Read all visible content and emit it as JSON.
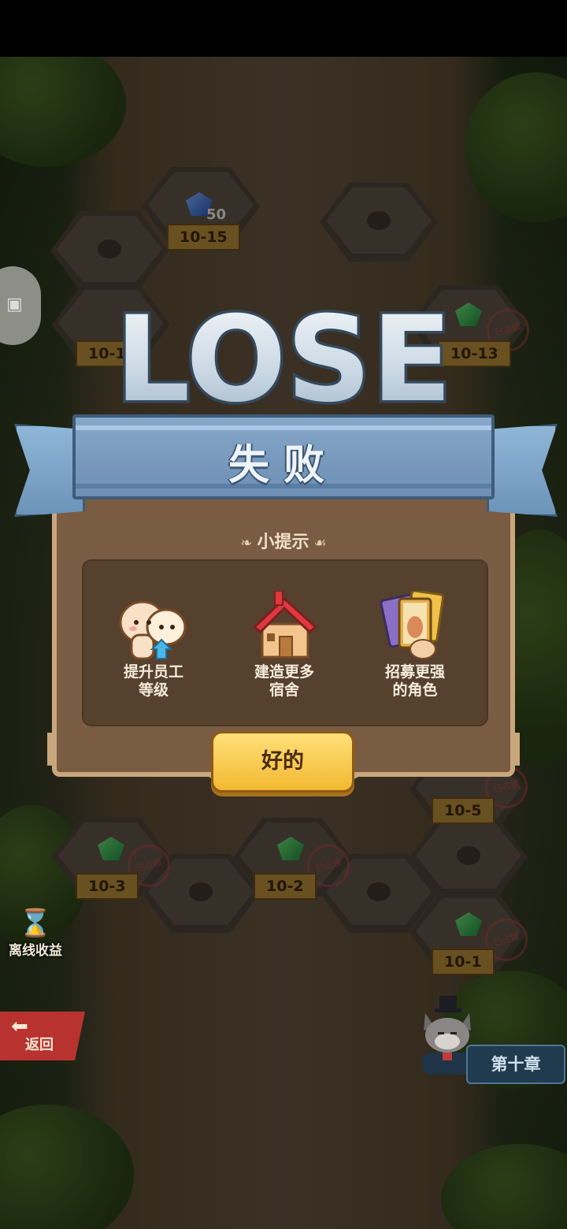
{
  "map": {
    "levels": [
      "10-15",
      "10-1",
      "10-13",
      "10-5",
      "10-3",
      "10-2",
      "10-1"
    ],
    "claimed_stamp": "已占领",
    "gem_count": "50"
  },
  "sidebar": {
    "offline_income_label": "离线收益",
    "back_label": "返回",
    "chapter_label": "第十章"
  },
  "result": {
    "title_en": "LOSE",
    "title_cn": "失败",
    "hint_header": "小提示",
    "tips": [
      {
        "label": "提升员工\n等级",
        "icon": "upgrade-staff-icon"
      },
      {
        "label": "建造更多\n宿舍",
        "icon": "house-icon"
      },
      {
        "label": "招募更强\n的角色",
        "icon": "cards-icon"
      }
    ],
    "ok_label": "好的"
  },
  "colors": {
    "accent_button": "#f3b830",
    "ribbon": "#6d8fb3",
    "panel": "#7a5c43"
  }
}
